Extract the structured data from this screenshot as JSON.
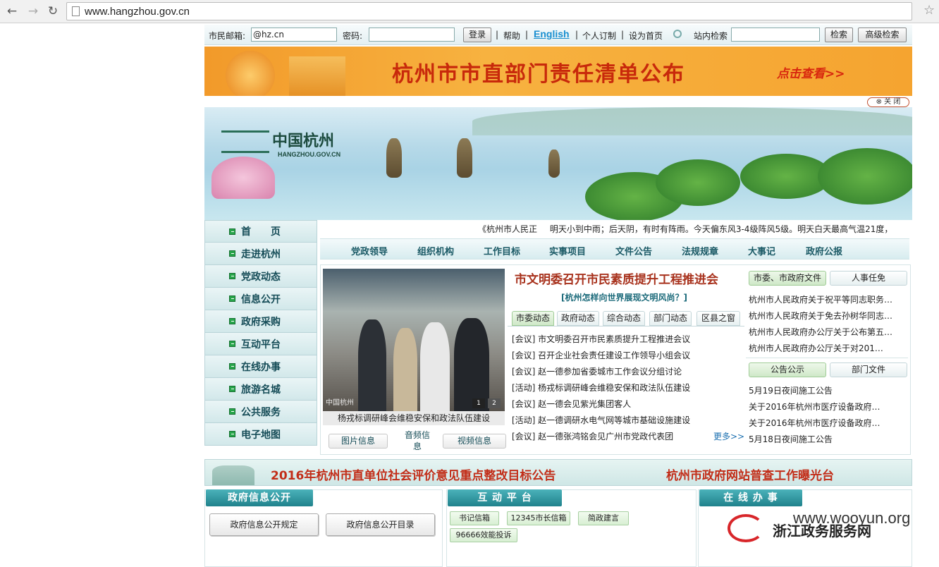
{
  "browser": {
    "url": "www.hangzhou.gov.cn"
  },
  "login_bar": {
    "email_label": "市民邮箱:",
    "email_value": "@hz.cn",
    "password_label": "密码:",
    "login_button": "登录",
    "help_link": "帮助",
    "english_link": "English",
    "custom_link": "个人订制",
    "homepage_link": "设为首页",
    "search_label": "站内检索",
    "search_button": "检索",
    "advanced_search_button": "高级检索"
  },
  "ad_banner": {
    "title": "杭州市市直部门责任清单公布",
    "link": "点击查看>>",
    "close_label": "⊗ 关 闭"
  },
  "site": {
    "logo_text": "中国杭州",
    "logo_sub": "HANGZHOU.GOV.CN"
  },
  "left_nav": {
    "items": [
      {
        "label": "首　　页"
      },
      {
        "label": "走进杭州"
      },
      {
        "label": "党政动态"
      },
      {
        "label": "信息公开"
      },
      {
        "label": "政府采购"
      },
      {
        "label": "互动平台"
      },
      {
        "label": "在线办事"
      },
      {
        "label": "旅游名城"
      },
      {
        "label": "公共服务"
      },
      {
        "label": "电子地图"
      }
    ]
  },
  "ticker": {
    "prefix": "《杭州市人民正",
    "weather": "明天小到中雨；后天阴，有时有阵雨。今天偏东风3-4级阵风5级。明天白天最高气温21度，"
  },
  "categories": [
    "党政领导",
    "组织机构",
    "工作目标",
    "实事项目",
    "文件公告",
    "法规规章",
    "大事记",
    "政府公报"
  ],
  "photo": {
    "caption": "杨戎标调研峰会维稳安保和政法队伍建设",
    "logo": "中国杭州",
    "pages": [
      "1",
      "2"
    ]
  },
  "media_tabs": {
    "picture": "图片信息",
    "audio": "音频信息",
    "video": "视频信息"
  },
  "main_news": {
    "headline": "市文明委召开市民素质提升工程推进会",
    "subhead": "[杭州怎样向世界展现文明风尚？]",
    "tabs": [
      "市委动态",
      "政府动态",
      "综合动态",
      "部门动态",
      "区县之窗"
    ],
    "items": [
      "[会议] 市文明委召开市民素质提升工程推进会议",
      "[会议] 召开企业社会责任建设工作领导小组会议",
      "[会议] 赵一德参加省委城市工作会议分组讨论",
      "[活动] 杨戎标调研峰会维稳安保和政法队伍建设",
      "[会议] 赵一德会见紫光集团客人",
      "[活动] 赵一德调研水电气网等城市基础设施建设",
      "[会议] 赵一德张鸿铭会见广州市党政代表团"
    ],
    "more": "更多>>"
  },
  "side_docs": {
    "tabs": [
      "市委、市政府文件",
      "人事任免"
    ],
    "items": [
      "杭州市人民政府关于祝平等同志职务…",
      "杭州市人民政府关于免去孙树华同志…",
      "杭州市人民政府办公厅关于公布第五…",
      "杭州市人民政府办公厅关于对201…"
    ]
  },
  "side_notices": {
    "tabs": [
      "公告公示",
      "部门文件"
    ],
    "items": [
      "5月19日夜间施工公告",
      "关于2016年杭州市医疗设备政府…",
      "关于2016年杭州市医疗设备政府…",
      "5月18日夜间施工公告"
    ]
  },
  "bottom_banner": {
    "left": "2016年杭州市直单位社会评价意见重点整改目标公告",
    "right": "杭州市政府网站普查工作曝光台"
  },
  "sections": {
    "gov_info": {
      "title": "政府信息公开",
      "buttons": [
        "政府信息公开规定",
        "政府信息公开目录"
      ]
    },
    "interaction": {
      "title": "互 动 平 台",
      "buttons": [
        "书记信箱",
        "12345市长信箱",
        "简政建言",
        "96666效能投诉"
      ]
    },
    "online": {
      "title": "在 线 办 事",
      "portal": "浙江政务服务网"
    }
  },
  "watermark": "www.wooyun.org"
}
